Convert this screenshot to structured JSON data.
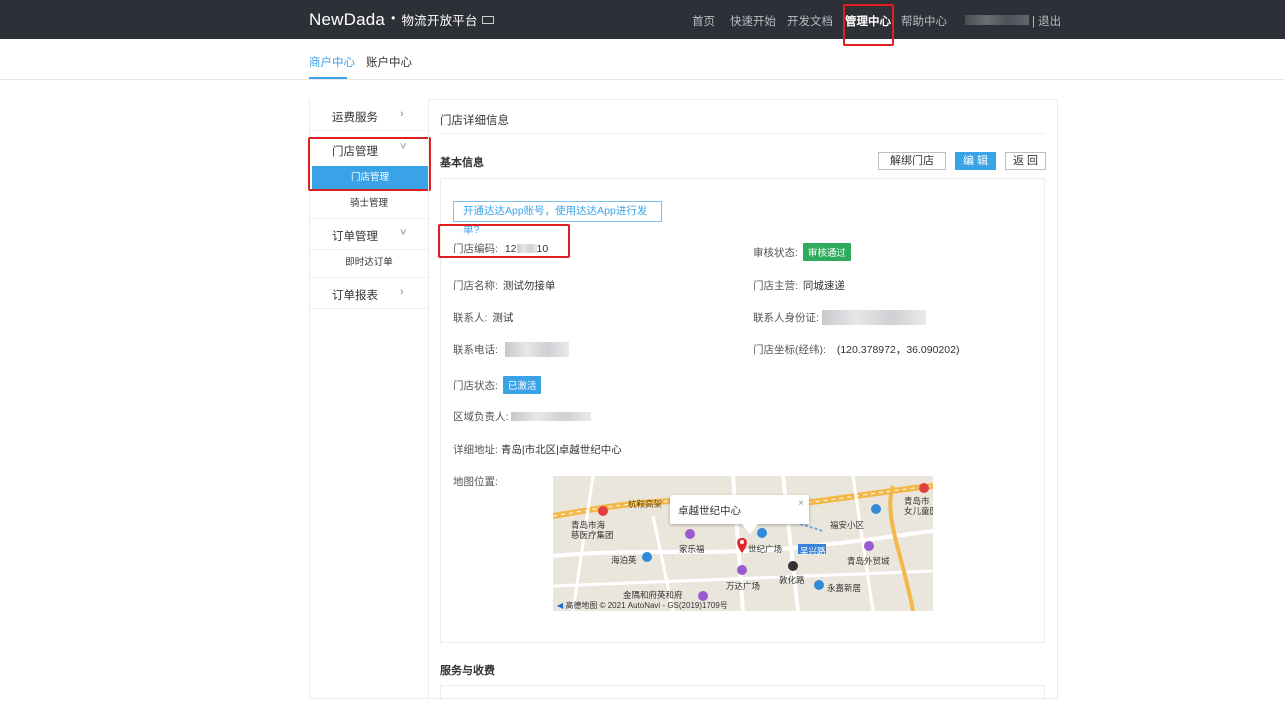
{
  "header": {
    "brand": "NewDada",
    "brand_sub": "物流开放平台",
    "nav": [
      {
        "label": "首页"
      },
      {
        "label": "快速开始"
      },
      {
        "label": "开发文档"
      },
      {
        "label": "管理中心"
      },
      {
        "label": "帮助中心"
      }
    ],
    "logout": "| 退出"
  },
  "subtabs": [
    "商户中心",
    "账户中心"
  ],
  "sidebar": {
    "groups": [
      {
        "label": "运费服务",
        "arrow": "›"
      },
      {
        "label": "门店管理",
        "arrow": "˅"
      },
      {
        "label": "订单管理",
        "arrow": "˅"
      },
      {
        "label": "订单报表",
        "arrow": "›"
      }
    ],
    "subitems": [
      "门店管理",
      "骑士管理",
      "即时达订单"
    ]
  },
  "page": {
    "title": "门店详细信息",
    "section_basic": "基本信息",
    "section_service": "服务与收费",
    "buttons": {
      "unbind": "解绑门店",
      "edit": "编 辑",
      "back": "返 回"
    },
    "hint": "开通达达App账号，使用达达App进行发单?"
  },
  "store": {
    "code_label": "门店编码:",
    "code_prefix": "12",
    "code_suffix": "10",
    "audit_label": "审核状态:",
    "audit_badge": "审核通过",
    "name_label": "门店名称:",
    "name_value": "测试勿接单",
    "business_label": "门店主营:",
    "business_value": "同城速递",
    "contact_label": "联系人:",
    "contact_value": "测试",
    "id_label": "联系人身份证:",
    "phone_label": "联系电话:",
    "coords_label": "门店坐标(经纬):",
    "coords_value": "(120.378972，36.090202)",
    "status_label": "门店状态:",
    "status_badge": "已激活",
    "region_label": "区域负责人:",
    "address_label": "详细地址:",
    "address_value": "青岛|市北区|卓越世纪中心",
    "map_label": "地图位置:"
  },
  "map": {
    "popup_title": "卓越世纪中心",
    "close": "×",
    "labels": [
      "杭鞍高架",
      "青岛市海\n慈医疗集团",
      "家乐福",
      "海泊英",
      "世纪广场",
      "吴兴路",
      "福安小区",
      "青岛外贸城",
      "敦化路",
      "万达广场",
      "永嘉新居",
      "金隅和府英和府",
      "青岛市\n女儿童医"
    ],
    "copyright": "高德地图 © 2021 AutoNavi - GS(2019)1709号"
  }
}
